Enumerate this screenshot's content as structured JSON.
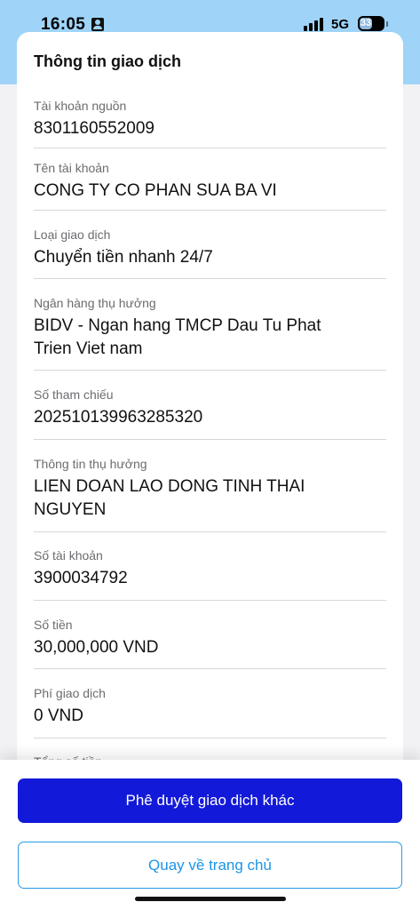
{
  "status_bar": {
    "time": "16:05",
    "network": "5G",
    "battery": "33",
    "battery_level": 0.33
  },
  "card": {
    "title": "Thông tin giao dịch",
    "fields": [
      {
        "label": "Tài khoản nguồn",
        "value": "8301160552009"
      },
      {
        "label": "Tên tài khoản",
        "value": "CONG TY CO PHAN SUA BA VI"
      },
      {
        "label": "Loại giao dịch",
        "value": "Chuyển tiền nhanh 24/7"
      },
      {
        "label": "Ngân hàng thụ hưởng",
        "value": "BIDV - Ngan hang TMCP Dau Tu Phat",
        "value2": "Trien Viet nam"
      },
      {
        "label": "Số tham chiếu",
        "value": "202510139963285320"
      },
      {
        "label": "Thông tin thụ hưởng",
        "value": "LIEN DOAN LAO DONG TINH THAI",
        "value2": "NGUYEN"
      },
      {
        "label": "Số tài khoản",
        "value": "3900034792"
      },
      {
        "label": "Số tiền",
        "value": "30,000,000 VND"
      },
      {
        "label": "Phí giao dịch",
        "value": "0 VND"
      },
      {
        "label": "Tổng số tiền"
      }
    ]
  },
  "actions": {
    "approve_other": "Phê duyệt giao dịch khác",
    "go_home": "Quay về trang chủ"
  },
  "colors": {
    "primary": "#1219d8",
    "secondary_text": "#1a95e8",
    "header_bg": "#9fd4f8"
  }
}
